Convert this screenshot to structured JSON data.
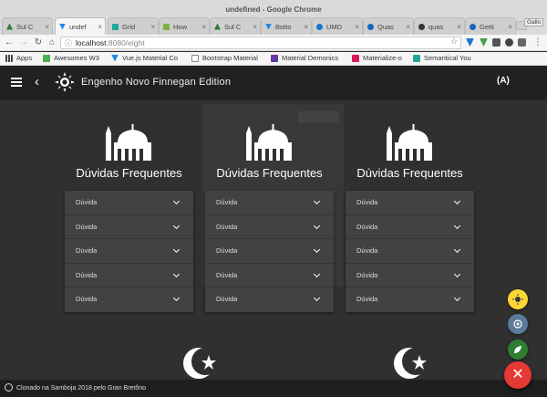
{
  "window": {
    "title": "undefined - Google Chrome"
  },
  "tabs": [
    {
      "label": "Sul C",
      "color": "#2e7d32"
    },
    {
      "label": "undef",
      "color": "#1e88e5"
    },
    {
      "label": "Grid",
      "color": "#26a69a"
    },
    {
      "label": "How",
      "color": "#7cb342"
    },
    {
      "label": "Sul C",
      "color": "#2e7d32"
    },
    {
      "label": "Botto",
      "color": "#1e88e5"
    },
    {
      "label": "UMD",
      "color": "#1976d2"
    },
    {
      "label": "Quas",
      "color": "#1565c0"
    },
    {
      "label": "quas",
      "color": "#333333"
    },
    {
      "label": "Getti",
      "color": "#1565c0"
    }
  ],
  "profile": "Gallo",
  "address": {
    "host": "localhost",
    "path": ":8080/eight"
  },
  "bookmarks": [
    {
      "label": "Apps",
      "color": "#444444"
    },
    {
      "label": "Awesomes W3",
      "color": "#4caf50"
    },
    {
      "label": "Vue.js Material Co",
      "color": "#1e88e5"
    },
    {
      "label": "Bootstrap Material",
      "color": "#888888"
    },
    {
      "label": "Material Demonics",
      "color": "#8e24aa"
    },
    {
      "label": "Materialize-o",
      "color": "#d81b60"
    },
    {
      "label": "Semantical You",
      "color": "#26a69a"
    }
  ],
  "app": {
    "title": "Engenho Novo Finnegan Edition",
    "cast_label": "(A)"
  },
  "faq": {
    "title": "Dúvidas Frequentes",
    "columns": [
      {
        "items": [
          "Dúvida",
          "Dúvida",
          "Dúvida",
          "Dúvida",
          "Dúvida"
        ]
      },
      {
        "items": [
          "Dúvida",
          "Dúvida",
          "Dúvida",
          "Dúvida",
          "Dúvida"
        ]
      },
      {
        "items": [
          "Dúvida",
          "Dúvida",
          "Dúvida",
          "Dúvida",
          "Dúvida"
        ]
      }
    ]
  },
  "footer": {
    "text": "Clonado na Samboja 2018 pelo Gran Bretôno"
  },
  "fabs": {
    "mini": [
      {
        "name": "fab-yellow",
        "color": "#fdd835",
        "icon": "sun-icon"
      },
      {
        "name": "fab-blue",
        "color": "#5c7a99",
        "icon": "target-icon"
      },
      {
        "name": "fab-green",
        "color": "#2e7d32",
        "icon": "leaf-icon"
      }
    ],
    "main": {
      "color": "#e53935",
      "icon": "close-icon",
      "label": "✕"
    }
  },
  "colors": {
    "appbar": "#212121",
    "content": "#303030",
    "card": "#424242"
  }
}
